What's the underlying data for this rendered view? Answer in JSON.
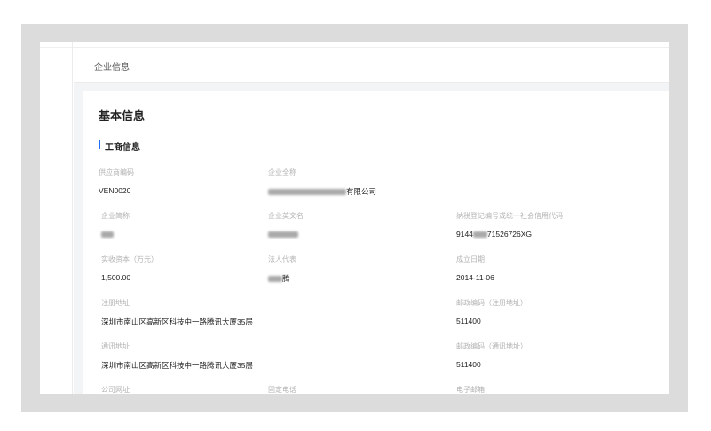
{
  "header": {
    "title": "企业信息"
  },
  "card": {
    "title": "基本信息"
  },
  "section": {
    "title": "工商信息"
  },
  "fields": {
    "supplier_code": {
      "label": "供应商编码",
      "value": "VEN0020"
    },
    "full_name": {
      "label": "企业全称",
      "value_suffix": "有限公司"
    },
    "short_name": {
      "label": "企业简称"
    },
    "english_name": {
      "label": "企业英文名"
    },
    "tax_code": {
      "label": "纳税登记编号或统一社会信用代码",
      "value_prefix": "9144",
      "value_suffix": "71526726XG"
    },
    "capital": {
      "label": "实收资本（万元）",
      "value": "1,500.00"
    },
    "legal_rep": {
      "label": "法人代表",
      "value_suffix": "腾"
    },
    "established": {
      "label": "成立日期",
      "value": "2014-11-06"
    },
    "reg_address": {
      "label": "注册地址",
      "value": "深圳市南山区高新区科技中一路腾讯大厦35层"
    },
    "reg_zip": {
      "label": "邮政编码（注册地址）",
      "value": "511400"
    },
    "mail_address": {
      "label": "通讯地址",
      "value": "深圳市南山区高新区科技中一路腾讯大厦35层"
    },
    "mail_zip": {
      "label": "邮政编码（通讯地址）",
      "value": "511400"
    },
    "website": {
      "label": "公司网址"
    },
    "phone": {
      "label": "固定电话"
    },
    "email": {
      "label": "电子邮箱"
    }
  }
}
